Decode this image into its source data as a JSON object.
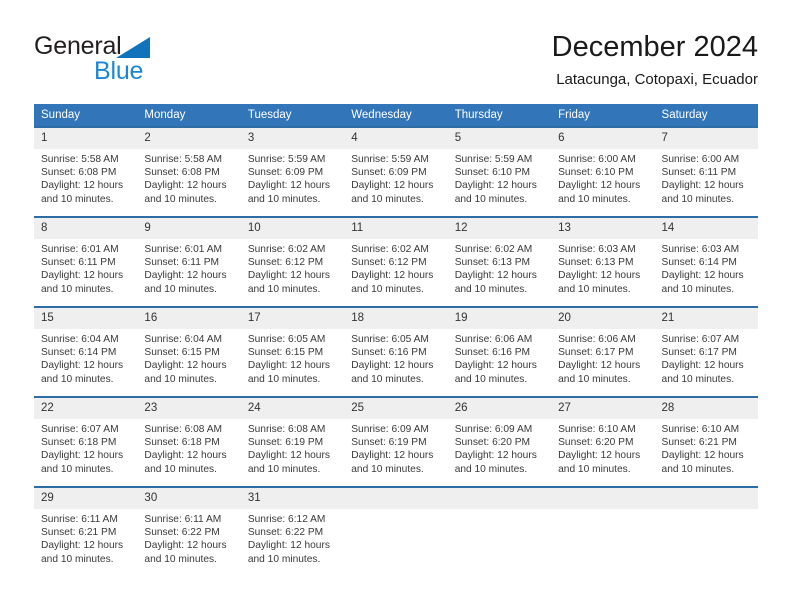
{
  "brand": {
    "name_part1": "General",
    "name_part2": "Blue",
    "logo_icon": "triangle-flag-icon"
  },
  "header": {
    "title": "December 2024",
    "subtitle": "Latacunga, Cotopaxi, Ecuador"
  },
  "calendar": {
    "weekday_headers": [
      "Sunday",
      "Monday",
      "Tuesday",
      "Wednesday",
      "Thursday",
      "Friday",
      "Saturday"
    ],
    "accent_color": "#3275b8",
    "row_border_color": "#2e6da4",
    "daynum_background": "#efefef",
    "weeks": [
      [
        {
          "day": "1",
          "sunrise": "Sunrise: 5:58 AM",
          "sunset": "Sunset: 6:08 PM",
          "daylight": "Daylight: 12 hours and 10 minutes."
        },
        {
          "day": "2",
          "sunrise": "Sunrise: 5:58 AM",
          "sunset": "Sunset: 6:08 PM",
          "daylight": "Daylight: 12 hours and 10 minutes."
        },
        {
          "day": "3",
          "sunrise": "Sunrise: 5:59 AM",
          "sunset": "Sunset: 6:09 PM",
          "daylight": "Daylight: 12 hours and 10 minutes."
        },
        {
          "day": "4",
          "sunrise": "Sunrise: 5:59 AM",
          "sunset": "Sunset: 6:09 PM",
          "daylight": "Daylight: 12 hours and 10 minutes."
        },
        {
          "day": "5",
          "sunrise": "Sunrise: 5:59 AM",
          "sunset": "Sunset: 6:10 PM",
          "daylight": "Daylight: 12 hours and 10 minutes."
        },
        {
          "day": "6",
          "sunrise": "Sunrise: 6:00 AM",
          "sunset": "Sunset: 6:10 PM",
          "daylight": "Daylight: 12 hours and 10 minutes."
        },
        {
          "day": "7",
          "sunrise": "Sunrise: 6:00 AM",
          "sunset": "Sunset: 6:11 PM",
          "daylight": "Daylight: 12 hours and 10 minutes."
        }
      ],
      [
        {
          "day": "8",
          "sunrise": "Sunrise: 6:01 AM",
          "sunset": "Sunset: 6:11 PM",
          "daylight": "Daylight: 12 hours and 10 minutes."
        },
        {
          "day": "9",
          "sunrise": "Sunrise: 6:01 AM",
          "sunset": "Sunset: 6:11 PM",
          "daylight": "Daylight: 12 hours and 10 minutes."
        },
        {
          "day": "10",
          "sunrise": "Sunrise: 6:02 AM",
          "sunset": "Sunset: 6:12 PM",
          "daylight": "Daylight: 12 hours and 10 minutes."
        },
        {
          "day": "11",
          "sunrise": "Sunrise: 6:02 AM",
          "sunset": "Sunset: 6:12 PM",
          "daylight": "Daylight: 12 hours and 10 minutes."
        },
        {
          "day": "12",
          "sunrise": "Sunrise: 6:02 AM",
          "sunset": "Sunset: 6:13 PM",
          "daylight": "Daylight: 12 hours and 10 minutes."
        },
        {
          "day": "13",
          "sunrise": "Sunrise: 6:03 AM",
          "sunset": "Sunset: 6:13 PM",
          "daylight": "Daylight: 12 hours and 10 minutes."
        },
        {
          "day": "14",
          "sunrise": "Sunrise: 6:03 AM",
          "sunset": "Sunset: 6:14 PM",
          "daylight": "Daylight: 12 hours and 10 minutes."
        }
      ],
      [
        {
          "day": "15",
          "sunrise": "Sunrise: 6:04 AM",
          "sunset": "Sunset: 6:14 PM",
          "daylight": "Daylight: 12 hours and 10 minutes."
        },
        {
          "day": "16",
          "sunrise": "Sunrise: 6:04 AM",
          "sunset": "Sunset: 6:15 PM",
          "daylight": "Daylight: 12 hours and 10 minutes."
        },
        {
          "day": "17",
          "sunrise": "Sunrise: 6:05 AM",
          "sunset": "Sunset: 6:15 PM",
          "daylight": "Daylight: 12 hours and 10 minutes."
        },
        {
          "day": "18",
          "sunrise": "Sunrise: 6:05 AM",
          "sunset": "Sunset: 6:16 PM",
          "daylight": "Daylight: 12 hours and 10 minutes."
        },
        {
          "day": "19",
          "sunrise": "Sunrise: 6:06 AM",
          "sunset": "Sunset: 6:16 PM",
          "daylight": "Daylight: 12 hours and 10 minutes."
        },
        {
          "day": "20",
          "sunrise": "Sunrise: 6:06 AM",
          "sunset": "Sunset: 6:17 PM",
          "daylight": "Daylight: 12 hours and 10 minutes."
        },
        {
          "day": "21",
          "sunrise": "Sunrise: 6:07 AM",
          "sunset": "Sunset: 6:17 PM",
          "daylight": "Daylight: 12 hours and 10 minutes."
        }
      ],
      [
        {
          "day": "22",
          "sunrise": "Sunrise: 6:07 AM",
          "sunset": "Sunset: 6:18 PM",
          "daylight": "Daylight: 12 hours and 10 minutes."
        },
        {
          "day": "23",
          "sunrise": "Sunrise: 6:08 AM",
          "sunset": "Sunset: 6:18 PM",
          "daylight": "Daylight: 12 hours and 10 minutes."
        },
        {
          "day": "24",
          "sunrise": "Sunrise: 6:08 AM",
          "sunset": "Sunset: 6:19 PM",
          "daylight": "Daylight: 12 hours and 10 minutes."
        },
        {
          "day": "25",
          "sunrise": "Sunrise: 6:09 AM",
          "sunset": "Sunset: 6:19 PM",
          "daylight": "Daylight: 12 hours and 10 minutes."
        },
        {
          "day": "26",
          "sunrise": "Sunrise: 6:09 AM",
          "sunset": "Sunset: 6:20 PM",
          "daylight": "Daylight: 12 hours and 10 minutes."
        },
        {
          "day": "27",
          "sunrise": "Sunrise: 6:10 AM",
          "sunset": "Sunset: 6:20 PM",
          "daylight": "Daylight: 12 hours and 10 minutes."
        },
        {
          "day": "28",
          "sunrise": "Sunrise: 6:10 AM",
          "sunset": "Sunset: 6:21 PM",
          "daylight": "Daylight: 12 hours and 10 minutes."
        }
      ],
      [
        {
          "day": "29",
          "sunrise": "Sunrise: 6:11 AM",
          "sunset": "Sunset: 6:21 PM",
          "daylight": "Daylight: 12 hours and 10 minutes."
        },
        {
          "day": "30",
          "sunrise": "Sunrise: 6:11 AM",
          "sunset": "Sunset: 6:22 PM",
          "daylight": "Daylight: 12 hours and 10 minutes."
        },
        {
          "day": "31",
          "sunrise": "Sunrise: 6:12 AM",
          "sunset": "Sunset: 6:22 PM",
          "daylight": "Daylight: 12 hours and 10 minutes."
        },
        {
          "day": "",
          "sunrise": "",
          "sunset": "",
          "daylight": ""
        },
        {
          "day": "",
          "sunrise": "",
          "sunset": "",
          "daylight": ""
        },
        {
          "day": "",
          "sunrise": "",
          "sunset": "",
          "daylight": ""
        },
        {
          "day": "",
          "sunrise": "",
          "sunset": "",
          "daylight": ""
        }
      ]
    ]
  }
}
